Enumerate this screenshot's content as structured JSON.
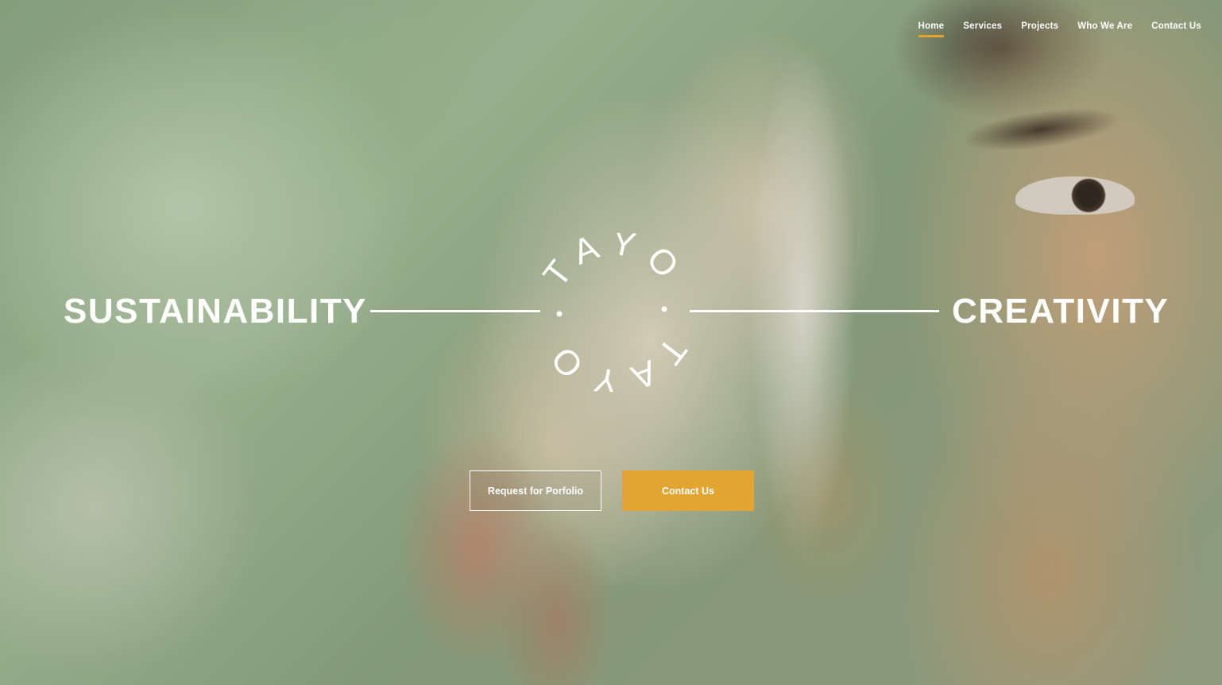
{
  "nav": {
    "items": [
      {
        "label": "Home",
        "active": true
      },
      {
        "label": "Services",
        "active": false
      },
      {
        "label": "Projects",
        "active": false
      },
      {
        "label": "Who We Are",
        "active": false
      },
      {
        "label": "Contact Us",
        "active": false
      }
    ]
  },
  "hero": {
    "left_word": "SUSTAINABILITY",
    "right_word": "CREATIVITY",
    "logo": {
      "top_text": "TAYO",
      "bottom_text": "TAYO"
    }
  },
  "buttons": {
    "portfolio_label": "Request for Porfolio",
    "contact_label": "Contact Us"
  },
  "colors": {
    "accent": "#e3a532",
    "text": "#ffffff"
  }
}
